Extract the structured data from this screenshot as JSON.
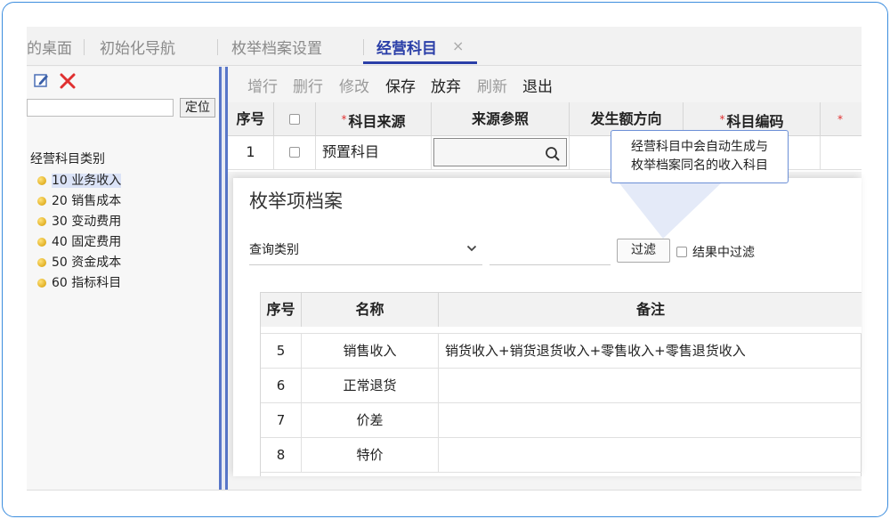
{
  "tabs": [
    {
      "label": "的桌面"
    },
    {
      "label": "初始化导航"
    },
    {
      "label": "枚举档案设置"
    },
    {
      "label": "经营科目",
      "active": true
    }
  ],
  "tab_close": "×",
  "left_panel": {
    "locate_button": "定位",
    "tree_root": "经营科目类别",
    "items": [
      {
        "label": "10 业务收入"
      },
      {
        "label": "20 销售成本"
      },
      {
        "label": "30 变动费用"
      },
      {
        "label": "40 固定费用"
      },
      {
        "label": "50 资金成本"
      },
      {
        "label": "60 指标科目"
      }
    ]
  },
  "toolbar": {
    "add_row": "增行",
    "delete_row": "删行",
    "modify": "修改",
    "save": "保存",
    "discard": "放弃",
    "refresh": "刷新",
    "exit": "退出"
  },
  "main_grid": {
    "headers": {
      "seq": "序号",
      "source": "科目来源",
      "source_ref": "来源参照",
      "direction": "发生额方向",
      "code": "科目编码"
    },
    "required_mark": "*",
    "rows": [
      {
        "seq": "1",
        "source": "预置科目"
      }
    ]
  },
  "callout": {
    "line1": "经营科目中会自动生成与",
    "line2": "枚举档案同名的收入科目"
  },
  "dialog": {
    "title": "枚举项档案",
    "query_select": "查询类别",
    "filter_button": "过滤",
    "filter_in_results": "结果中过滤",
    "headers": {
      "seq": "序号",
      "name": "名称",
      "note": "备注"
    },
    "rows": [
      {
        "seq": "5",
        "name": "销售收入",
        "note": "销货收入+销货退货收入+零售收入+零售退货收入"
      },
      {
        "seq": "6",
        "name": "正常退货",
        "note": ""
      },
      {
        "seq": "7",
        "name": "价差",
        "note": ""
      },
      {
        "seq": "8",
        "name": "特价",
        "note": ""
      }
    ]
  },
  "status_note": "备注",
  "colors": {
    "accent": "#2b3fa8",
    "frame_border": "#3c8dde",
    "delete_red": "#e03030",
    "divider_blue": "#5876c8"
  },
  "icons": [
    "edit-icon",
    "delete-icon",
    "search-icon",
    "chevron-down-icon",
    "tree-node-icon"
  ]
}
